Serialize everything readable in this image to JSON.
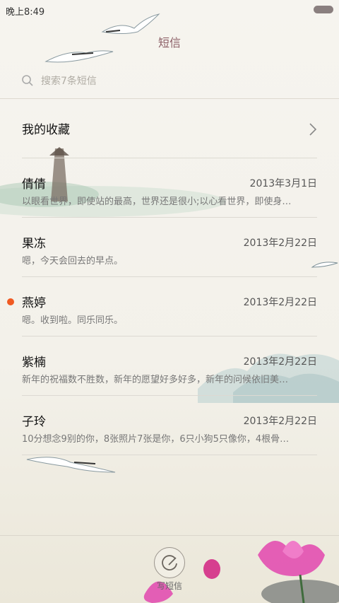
{
  "status_bar": {
    "time": "晚上8:49"
  },
  "header": {
    "title": "短信"
  },
  "search": {
    "placeholder": "搜索7条短信"
  },
  "favorites": {
    "label": "我的收藏"
  },
  "messages": [
    {
      "name": "倩倩",
      "date": "2013年3月1日",
      "preview": "以眼看世界，即使站的最高，世界还是很小;以心看世界，即使身…",
      "unread": false
    },
    {
      "name": "果冻",
      "date": "2013年2月22日",
      "preview": "嗯，今天会回去的早点。",
      "unread": false
    },
    {
      "name": "燕婷",
      "date": "2013年2月22日",
      "preview": "嗯。收到啦。同乐同乐。",
      "unread": true
    },
    {
      "name": "紫楠",
      "date": "2013年2月22日",
      "preview": "新年的祝福数不胜数，新年的愿望好多好多，新年的问候依旧美…",
      "unread": false
    },
    {
      "name": "子玲",
      "date": "2013年2月22日",
      "preview": "10分想念9别的你，8张照片7张是你，6只小狗5只像你，4根骨…",
      "unread": false
    }
  ],
  "compose": {
    "label": "写短信"
  },
  "colors": {
    "unread_dot": "#f05a22",
    "title": "#8c5f66"
  }
}
